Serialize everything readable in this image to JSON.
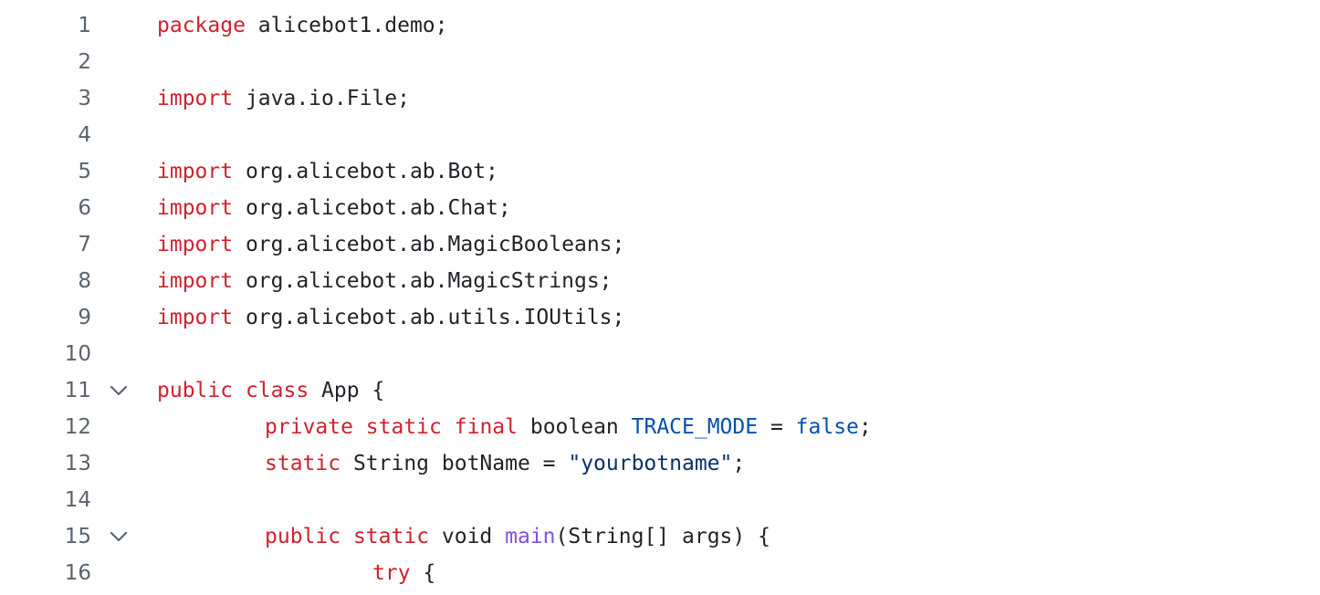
{
  "editor": {
    "lines": [
      {
        "number": "1",
        "foldable": false,
        "indent": 0,
        "tokens": [
          {
            "type": "keyword",
            "text": "package"
          },
          {
            "type": "plain",
            "text": " alicebot1.demo;"
          }
        ]
      },
      {
        "number": "2",
        "foldable": false,
        "indent": 0,
        "tokens": []
      },
      {
        "number": "3",
        "foldable": false,
        "indent": 0,
        "tokens": [
          {
            "type": "keyword",
            "text": "import"
          },
          {
            "type": "plain",
            "text": " java.io.File;"
          }
        ]
      },
      {
        "number": "4",
        "foldable": false,
        "indent": 0,
        "tokens": []
      },
      {
        "number": "5",
        "foldable": false,
        "indent": 0,
        "tokens": [
          {
            "type": "keyword",
            "text": "import"
          },
          {
            "type": "plain",
            "text": " org.alicebot.ab.Bot;"
          }
        ]
      },
      {
        "number": "6",
        "foldable": false,
        "indent": 0,
        "tokens": [
          {
            "type": "keyword",
            "text": "import"
          },
          {
            "type": "plain",
            "text": " org.alicebot.ab.Chat;"
          }
        ]
      },
      {
        "number": "7",
        "foldable": false,
        "indent": 0,
        "tokens": [
          {
            "type": "keyword",
            "text": "import"
          },
          {
            "type": "plain",
            "text": " org.alicebot.ab.MagicBooleans;"
          }
        ]
      },
      {
        "number": "8",
        "foldable": false,
        "indent": 0,
        "tokens": [
          {
            "type": "keyword",
            "text": "import"
          },
          {
            "type": "plain",
            "text": " org.alicebot.ab.MagicStrings;"
          }
        ]
      },
      {
        "number": "9",
        "foldable": false,
        "indent": 0,
        "tokens": [
          {
            "type": "keyword",
            "text": "import"
          },
          {
            "type": "plain",
            "text": " org.alicebot.ab.utils.IOUtils;"
          }
        ]
      },
      {
        "number": "10",
        "foldable": false,
        "indent": 0,
        "tokens": []
      },
      {
        "number": "11",
        "foldable": true,
        "indent": 0,
        "tokens": [
          {
            "type": "keyword",
            "text": "public"
          },
          {
            "type": "plain",
            "text": " "
          },
          {
            "type": "keyword",
            "text": "class"
          },
          {
            "type": "plain",
            "text": " App {"
          }
        ]
      },
      {
        "number": "12",
        "foldable": false,
        "indent": 1,
        "tokens": [
          {
            "type": "keyword",
            "text": "private"
          },
          {
            "type": "plain",
            "text": " "
          },
          {
            "type": "keyword",
            "text": "static"
          },
          {
            "type": "plain",
            "text": " "
          },
          {
            "type": "keyword",
            "text": "final"
          },
          {
            "type": "plain",
            "text": " boolean "
          },
          {
            "type": "const",
            "text": "TRACE_MODE"
          },
          {
            "type": "plain",
            "text": " = "
          },
          {
            "type": "const",
            "text": "false"
          },
          {
            "type": "plain",
            "text": ";"
          }
        ]
      },
      {
        "number": "13",
        "foldable": false,
        "indent": 1,
        "tokens": [
          {
            "type": "keyword",
            "text": "static"
          },
          {
            "type": "plain",
            "text": " String botName = "
          },
          {
            "type": "string",
            "text": "\"yourbotname\""
          },
          {
            "type": "plain",
            "text": ";"
          }
        ]
      },
      {
        "number": "14",
        "foldable": false,
        "indent": 0,
        "tokens": []
      },
      {
        "number": "15",
        "foldable": true,
        "indent": 1,
        "tokens": [
          {
            "type": "keyword",
            "text": "public"
          },
          {
            "type": "plain",
            "text": " "
          },
          {
            "type": "keyword",
            "text": "static"
          },
          {
            "type": "plain",
            "text": " void "
          },
          {
            "type": "func",
            "text": "main"
          },
          {
            "type": "plain",
            "text": "(String[] args) {"
          }
        ]
      },
      {
        "number": "16",
        "foldable": false,
        "indent": 2,
        "tokens": [
          {
            "type": "keyword",
            "text": "try"
          },
          {
            "type": "plain",
            "text": " {"
          }
        ]
      }
    ]
  },
  "icons": {
    "fold": "chevron-down-icon"
  },
  "colors": {
    "background": "#ffffff",
    "line_number": "#59636e",
    "keyword": "#cf222e",
    "plain": "#1f2328",
    "constant": "#0550ae",
    "string": "#0a3069",
    "function": "#8250df"
  }
}
